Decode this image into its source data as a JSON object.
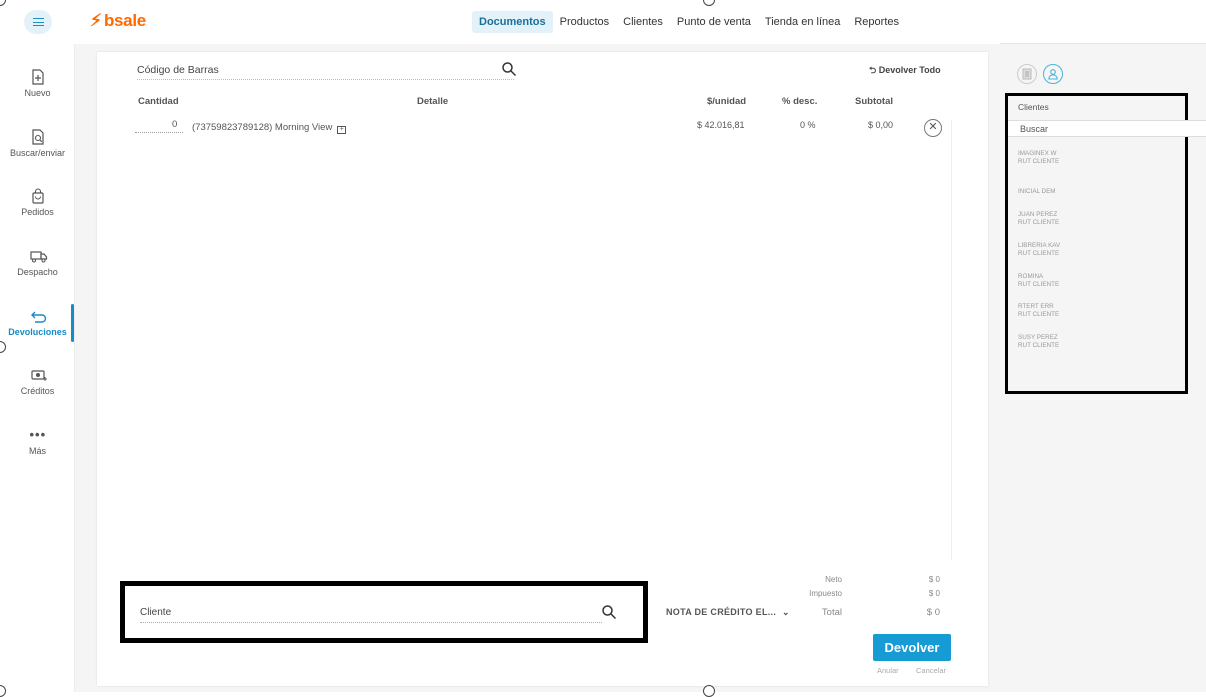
{
  "brand": {
    "name": "bsale"
  },
  "topnav": {
    "items": [
      {
        "label": "Documentos",
        "active": true
      },
      {
        "label": "Productos",
        "active": false
      },
      {
        "label": "Clientes",
        "active": false
      },
      {
        "label": "Punto de venta",
        "active": false
      },
      {
        "label": "Tienda en línea",
        "active": false
      },
      {
        "label": "Reportes",
        "active": false
      }
    ]
  },
  "sidebar": {
    "items": [
      {
        "label": "Nuevo",
        "icon": "new-document-icon",
        "active": false
      },
      {
        "label": "Buscar/enviar",
        "icon": "search-document-icon",
        "active": false
      },
      {
        "label": "Pedidos",
        "icon": "shopping-bag-icon",
        "active": false
      },
      {
        "label": "Despacho",
        "icon": "truck-icon",
        "active": false
      },
      {
        "label": "Devoluciones",
        "icon": "return-arrow-icon",
        "active": true
      },
      {
        "label": "Créditos",
        "icon": "money-icon",
        "active": false
      },
      {
        "label": "Más",
        "icon": "more-dots-icon",
        "active": false
      }
    ]
  },
  "document": {
    "barcode_placeholder": "Código de Barras",
    "return_all_label": "Devolver Todo",
    "columns": {
      "cantidad": "Cantidad",
      "detalle": "Detalle",
      "unidad": "$/unidad",
      "desc": "% desc.",
      "subtotal": "Subtotal"
    },
    "row": {
      "cantidad": "0",
      "detalle": "(73759823789128) Morning View",
      "unidad": "$ 42.016,81",
      "desc": "0 %",
      "subtotal": "$ 0,00"
    }
  },
  "footer": {
    "client_placeholder": "Cliente",
    "doc_type": "NOTA DE CRÉDITO EL...",
    "totals": {
      "neto_label": "Neto",
      "neto_value": "$ 0",
      "impuesto_label": "Impuesto",
      "impuesto_value": "$ 0",
      "total_label": "Total",
      "total_value": "$ 0"
    },
    "return_button": "Devolver",
    "anular": "Anular",
    "cancelar": "Cancelar"
  },
  "clients_panel": {
    "title": "Clientes",
    "search_placeholder": "Buscar",
    "clients": [
      {
        "name": "IMAGINEX W",
        "rut": "RUT CLIENTE"
      },
      {
        "name": "INICIAL DEM",
        "rut": ""
      },
      {
        "name": "JUAN PEREZ",
        "rut": "RUT CLIENTE"
      },
      {
        "name": "LIBRERIA KAV",
        "rut": "RUT CLIENTE"
      },
      {
        "name": "ROMINA",
        "rut": "RUT CLIENTE"
      },
      {
        "name": "RTERT ERR",
        "rut": "RUT CLIENTE"
      },
      {
        "name": "SUSY PEREZ",
        "rut": "RUT CLIENTE"
      }
    ]
  },
  "colors": {
    "brand": "#ff6a00",
    "accent": "#169bd5",
    "active_nav_bg": "#e3f2f9"
  }
}
